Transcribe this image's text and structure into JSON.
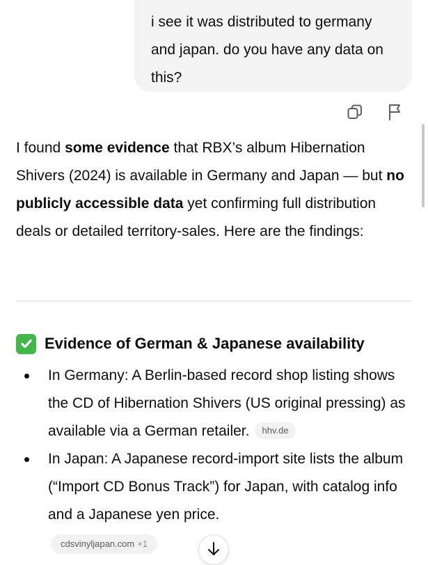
{
  "user_message": {
    "text": "i see it was distributed to germany and japan. do you have any data on this?"
  },
  "user_actions": {
    "copy_icon": "copy-icon",
    "flag_icon": "flag-icon"
  },
  "answer": {
    "intro_part1": "I found ",
    "intro_bold1": "some evidence",
    "intro_part2": " that RBX’s album Hibernation Shivers (2024) is available in Germany and Japan — but ",
    "intro_bold2": "no publicly accessible data",
    "intro_part3": " yet confirming full distribution deals or detailed territory-sales. Here are the findings:"
  },
  "section": {
    "emoji_icon": "check-mark-button-icon",
    "heading": "Evidence of German & Japanese availability",
    "bullets": [
      {
        "text": "In Germany: A Berlin-based record shop listing shows the CD of Hibernation Shivers (US original pressing) as available via a German retailer.",
        "source": "hhv.de"
      },
      {
        "text": "In Japan: A Japanese record-import site lists the album (“Import CD Bonus Track”) for Japan, with catalog info and a Japanese yen price."
      }
    ]
  },
  "sources": {
    "chip_label": "cdsvinyljapan.com",
    "extra_count": "+1"
  },
  "scroll_down_icon": "arrow-down-icon",
  "colors": {
    "bubble_bg": "#f4f4f4",
    "check_green": "#43b649",
    "chip_bg": "#f2f2f2",
    "text": "#0d0d0d"
  }
}
